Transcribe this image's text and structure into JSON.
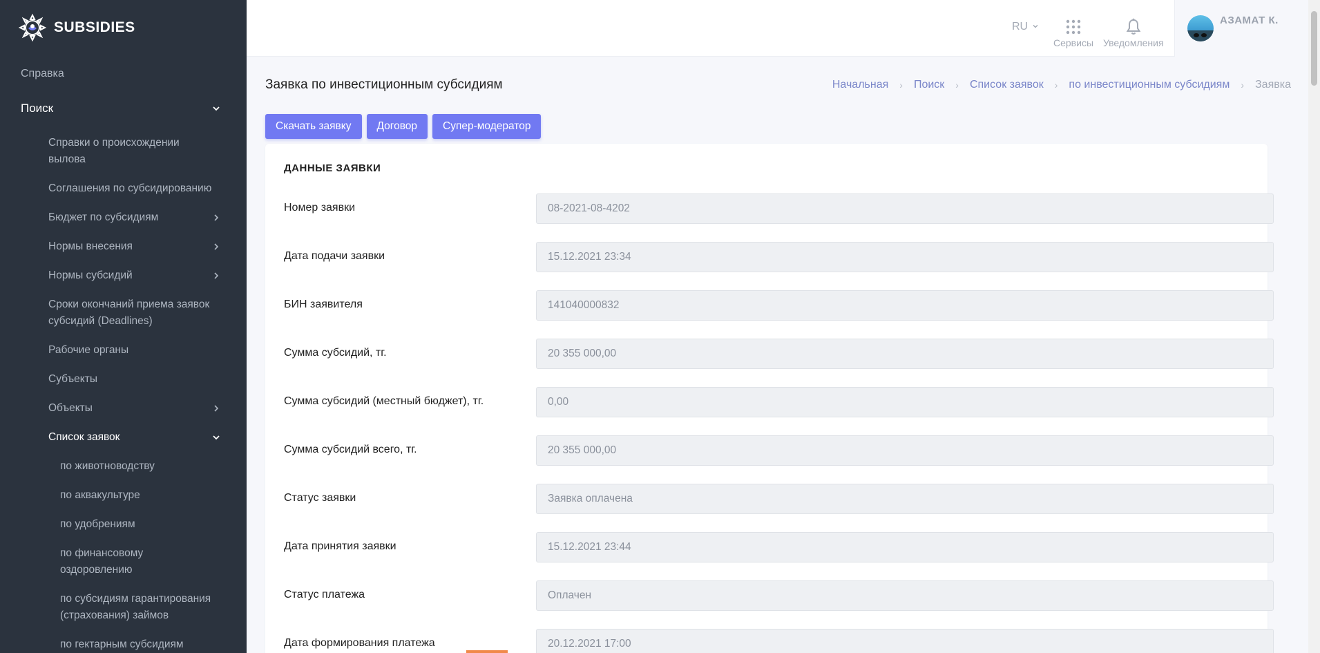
{
  "app": {
    "brand": "SUBSIDIES"
  },
  "sidebar": {
    "items": [
      {
        "label": "Справка",
        "level": 1
      },
      {
        "label": "Поиск",
        "level": 1,
        "expanded": true
      },
      {
        "label": "Справки о происхождении вылова",
        "level": 2
      },
      {
        "label": "Соглашения по субсидированию",
        "level": 2
      },
      {
        "label": "Бюджет по субсидиям",
        "level": 2,
        "hasChildren": true
      },
      {
        "label": "Нормы внесения",
        "level": 2,
        "hasChildren": true
      },
      {
        "label": "Нормы субсидий",
        "level": 2,
        "hasChildren": true
      },
      {
        "label": "Сроки окончаний приема заявок субсидий (Deadlines)",
        "level": 2
      },
      {
        "label": "Рабочие органы",
        "level": 2
      },
      {
        "label": "Субъекты",
        "level": 2
      },
      {
        "label": "Объекты",
        "level": 2,
        "hasChildren": true
      },
      {
        "label": "Список заявок",
        "level": 2,
        "expanded": true,
        "active": true
      },
      {
        "label": "по животноводству",
        "level": 3
      },
      {
        "label": "по аквакультуре",
        "level": 3
      },
      {
        "label": "по удобрениям",
        "level": 3
      },
      {
        "label": "по финансовому оздоровлению",
        "level": 3
      },
      {
        "label": "по субсидиям гарантирования (страхования) займов",
        "level": 3
      },
      {
        "label": "по гектарным субсидиям",
        "level": 3
      }
    ]
  },
  "topbar": {
    "language": "RU",
    "services_label": "Сервисы",
    "notifications_label": "Уведомления",
    "user_name": "АЗАМАТ К."
  },
  "page": {
    "title": "Заявка по инвестиционным субсидиям",
    "breadcrumb": [
      "Начальная",
      "Поиск",
      "Список заявок",
      "по инвестиционным субсидиям",
      "Заявка"
    ],
    "actions": [
      "Скачать заявку",
      "Договор",
      "Супер-модератор"
    ]
  },
  "card": {
    "title": "ДАННЫЕ ЗАЯВКИ",
    "fields": [
      {
        "label": "Номер заявки",
        "value": "08-2021-08-4202"
      },
      {
        "label": "Дата подачи заявки",
        "value": "15.12.2021 23:34"
      },
      {
        "label": "БИН заявителя",
        "value": "141040000832"
      },
      {
        "label": "Сумма субсидий, тг.",
        "value": "20 355 000,00"
      },
      {
        "label": "Сумма субсидий (местный бюджет), тг.",
        "value": "0,00"
      },
      {
        "label": "Сумма субсидий всего, тг.",
        "value": "20 355 000,00"
      },
      {
        "label": "Статус заявки",
        "value": "Заявка оплачена"
      },
      {
        "label": "Дата принятия заявки",
        "value": "15.12.2021 23:44"
      },
      {
        "label": "Статус платежа",
        "value": "Оплачен"
      },
      {
        "label": "Дата формирования платежа",
        "value": "20.12.2021 17:00"
      }
    ]
  },
  "colors": {
    "sidebar_bg": "#2b333e",
    "accent": "#7179f2",
    "input_bg": "#eef0f3"
  }
}
